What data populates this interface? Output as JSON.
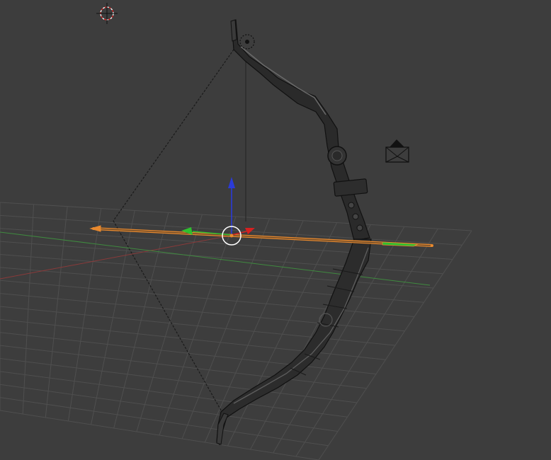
{
  "app": "3D viewport",
  "viewport": {
    "background": "#3d3d3d",
    "grid_color": "#4f4f4f",
    "x_axis_color": "#8a3a3a",
    "y_axis_color": "#3f8a3f"
  },
  "objects": [
    {
      "name": "bow",
      "kind": "mesh",
      "color": "#2a2a2a",
      "selected": false
    },
    {
      "name": "bowstring",
      "kind": "curve",
      "selected": false
    },
    {
      "name": "arrow",
      "kind": "mesh",
      "selected": true,
      "selection_color": "#e8892e"
    }
  ],
  "scene_helpers": {
    "cursor_icon": "3d-cursor-icon",
    "camera_icon": "camera-icon",
    "empty_icon": "empty-object-icon"
  },
  "gizmo": {
    "type": "translate",
    "axis_colors": {
      "x": "#d62020",
      "y": "#2fbf2f",
      "z": "#2b3bd8"
    },
    "pivot_color": "#ffffff"
  }
}
